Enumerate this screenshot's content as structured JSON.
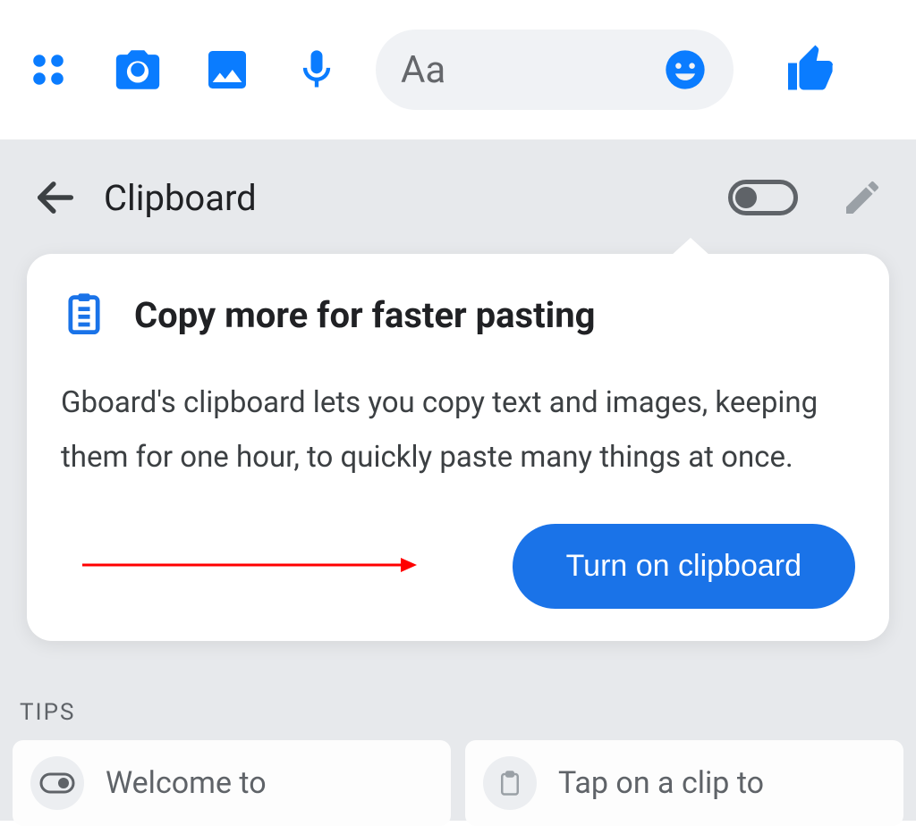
{
  "chat": {
    "placeholder": "Aa"
  },
  "keyboard": {
    "title": "Clipboard"
  },
  "popup": {
    "title": "Copy more for faster pasting",
    "body": "Gboard's clipboard lets you copy text and images, keeping them for one hour, to quickly paste many things at once.",
    "cta": "Turn on clipboard"
  },
  "tips": {
    "label": "TIPS",
    "items": [
      {
        "text": "Welcome to"
      },
      {
        "text": "Tap on a clip to"
      }
    ]
  },
  "colors": {
    "accent_blue": "#0a7cff",
    "google_blue": "#1a73e8",
    "kbd_bg": "#e7e9ec"
  }
}
